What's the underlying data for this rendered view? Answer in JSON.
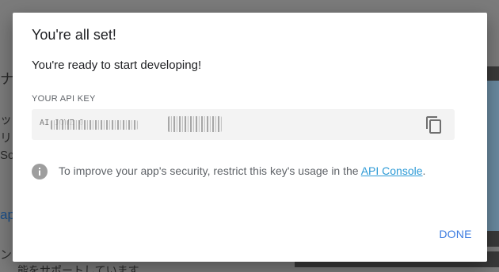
{
  "background": {
    "fragments": [
      "ナ(",
      "ップ",
      "リー",
      "Sc",
      "ap",
      "ンツ",
      "能をサポートしています"
    ]
  },
  "dialog": {
    "title": "You're all set!",
    "subtitle": "You're ready to start developing!",
    "key_label": "YOUR API KEY",
    "key_value": "AI                      JOWZ                   0",
    "copy_icon": "copy-icon",
    "info_icon": "info-icon",
    "info_text": "To improve your app's security, restrict this key's usage in the ",
    "info_link": "API Console",
    "info_suffix": ".",
    "done_label": "DONE"
  },
  "colors": {
    "accent": "#3b7be0",
    "link": "#2c9ad6",
    "scrim": "#7b7b7b"
  }
}
